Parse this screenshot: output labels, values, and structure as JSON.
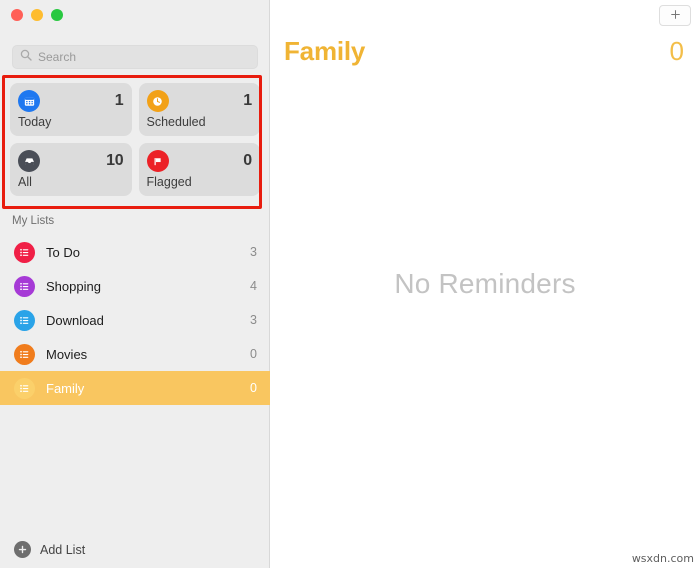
{
  "window": {
    "traffic_lights": [
      {
        "name": "close",
        "color": "#ff5f57"
      },
      {
        "name": "minimize",
        "color": "#febc2e"
      },
      {
        "name": "maximize",
        "color": "#28c840"
      }
    ]
  },
  "sidebar": {
    "search": {
      "placeholder": "Search",
      "value": "",
      "icon": "search-icon"
    },
    "smart_lists": [
      {
        "label": "Today",
        "count": "1",
        "icon": "calendar-icon",
        "color": "#1f78f0"
      },
      {
        "label": "Scheduled",
        "count": "1",
        "icon": "clock-icon",
        "color": "#f2a117"
      },
      {
        "label": "All",
        "count": "10",
        "icon": "inbox-icon",
        "color": "#4a4e57"
      },
      {
        "label": "Flagged",
        "count": "0",
        "icon": "flag-icon",
        "color": "#ec2127"
      }
    ],
    "section_title": "My Lists",
    "lists": [
      {
        "label": "To Do",
        "count": "3",
        "color": "#f01f46",
        "selected": false
      },
      {
        "label": "Shopping",
        "count": "4",
        "color": "#a63ad6",
        "selected": false
      },
      {
        "label": "Download",
        "count": "3",
        "color": "#2aa3e8",
        "selected": false
      },
      {
        "label": "Movies",
        "count": "0",
        "color": "#f07c1c",
        "selected": false
      },
      {
        "label": "Family",
        "count": "0",
        "color": "#fbd06a",
        "selected": true
      }
    ],
    "add_list": {
      "label": "Add List",
      "icon": "plus-circle-icon"
    }
  },
  "main": {
    "add_reminder_icon": "plus-icon",
    "title": "Family",
    "count": "0",
    "empty_message": "No Reminders"
  },
  "annotation": {
    "color": "#e81c0e",
    "target": "smart-lists-grid"
  },
  "watermark": "wsxdn.com"
}
